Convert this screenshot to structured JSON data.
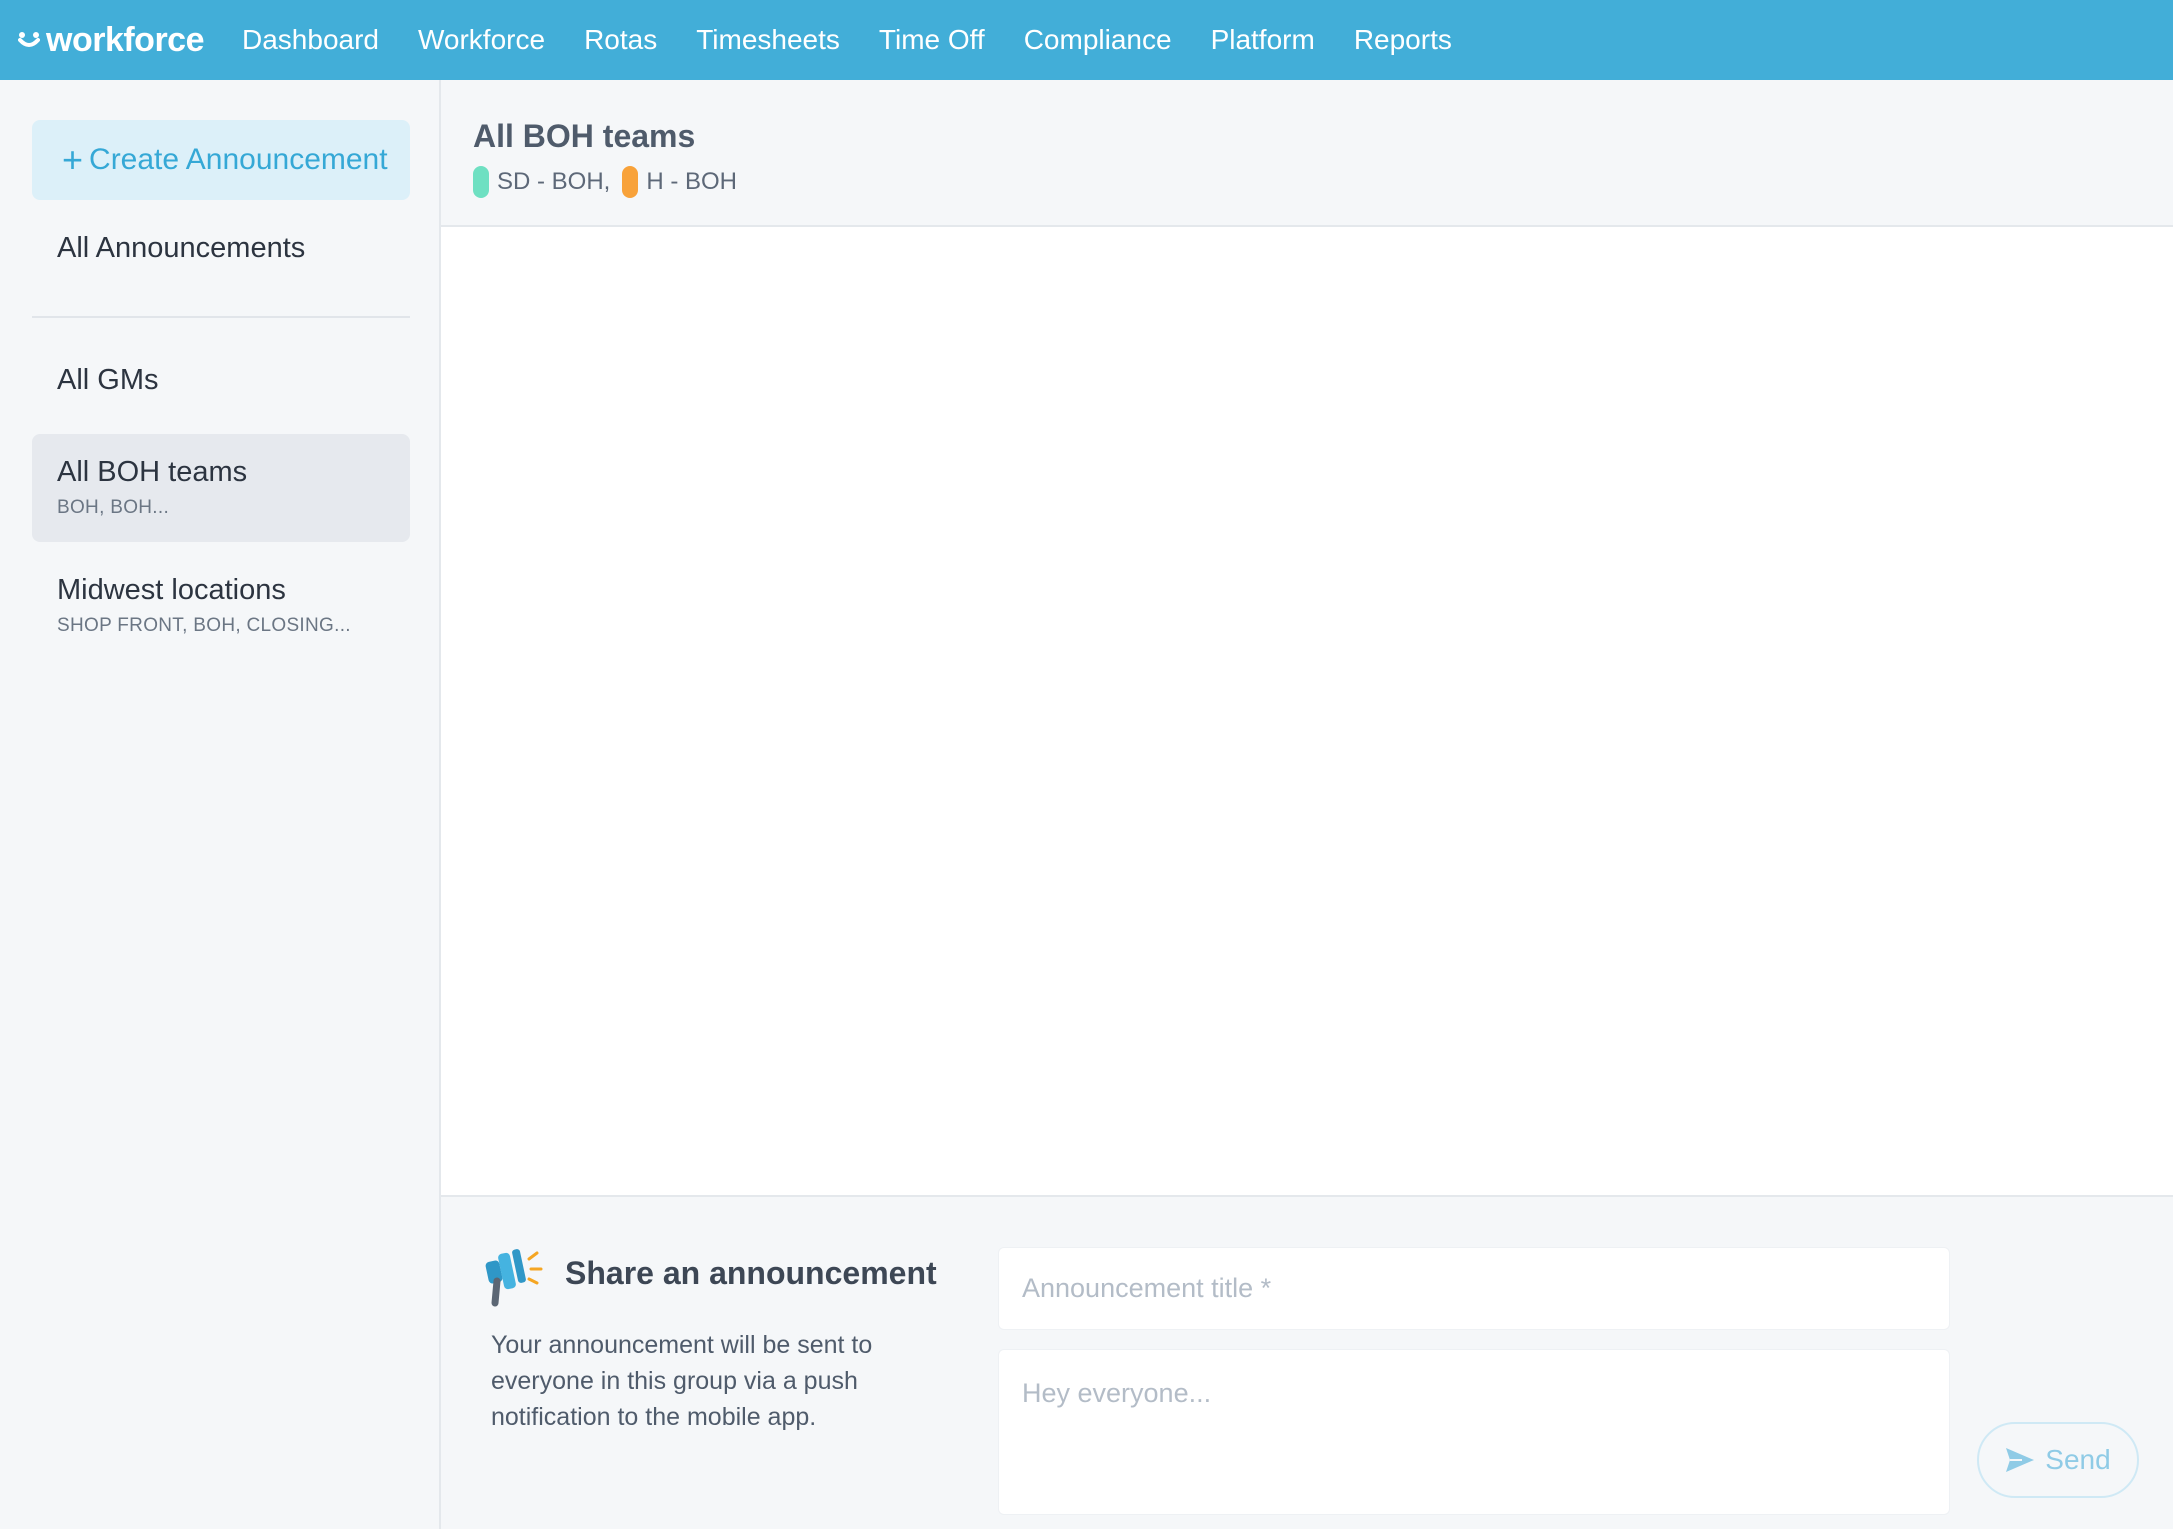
{
  "app": {
    "logo_text": "workforce"
  },
  "nav": {
    "items": [
      "Dashboard",
      "Workforce",
      "Rotas",
      "Timesheets",
      "Time Off",
      "Compliance",
      "Platform",
      "Reports"
    ]
  },
  "sidebar": {
    "create_label": "Create Announcement",
    "all_announcements": "All Announcements",
    "groups": [
      {
        "name": "All GMs",
        "sub": ""
      },
      {
        "name": "All BOH teams",
        "sub": "BOH, BOH..."
      },
      {
        "name": "Midwest locations",
        "sub": "SHOP FRONT, BOH, CLOSING..."
      }
    ]
  },
  "main": {
    "title": "All BOH teams",
    "teams": [
      {
        "label": "SD - BOH,",
        "color": "#6ee0c2"
      },
      {
        "label": "H - BOH",
        "color": "#f8a23a"
      }
    ]
  },
  "composer": {
    "heading": "Share an announcement",
    "description": "Your announcement will be sent to everyone in this group via a push notification to the mobile app.",
    "title_placeholder": "Announcement title *",
    "body_placeholder": "Hey everyone...",
    "send_label": "Send"
  },
  "colors": {
    "brand": "#42aed8",
    "accent": "#35a8d6",
    "selected_bg": "#e6e9ee"
  }
}
